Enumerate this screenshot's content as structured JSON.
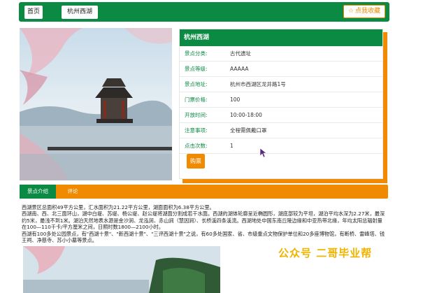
{
  "nav": {
    "home": "首页",
    "current": "杭州西湖",
    "favorite": "点我收藏"
  },
  "panel": {
    "title": "杭州西湖",
    "rows": [
      {
        "k": "景点分类:",
        "v": "古代遗址"
      },
      {
        "k": "景点等级:",
        "v": "AAAAA"
      },
      {
        "k": "景点地址:",
        "v": "杭州市西湖区龙井路1号"
      },
      {
        "k": "门票价格:",
        "v": "100"
      },
      {
        "k": "开放时间:",
        "v": "10:00-18:00"
      },
      {
        "k": "注意事项:",
        "v": "全程需佩戴口罩"
      },
      {
        "k": "点击次数:",
        "v": "1"
      }
    ],
    "buy": "购票"
  },
  "tabs": {
    "intro": "景点介绍",
    "comment": "评论"
  },
  "description": [
    "西湖景区总面积49平方公里，汇水面积为21.22平方公里，湖面面积为6.38平方公里。",
    "西湖南、西、北三面环山，湖中白堤、苏堤、杨公堤、赵公堤将湖面分割成若干水面。西湖的湖体轮廓呈近椭圆形，湖底部较为平坦，湖泊平均水深为2.27米，最深约5米，最浅不到1米。湖泊天然地表水源是金沙涧、龙泓涧、赤山涧（慧因涧）、长桥溪四条溪流。西湖地处中国东南丘陵边缘和中亚热带北缘，年均太阳总辐射量在100—110千卡/平方厘米之间，日照时数1800—2100小时。",
    "西湖有100多处公园景点，有\"西湖十景\"、\"新西湖十景\"、\"三评西湖十景\"之说，有60多处国家、省、市级重点文物保护单位和20多座博物馆，有断桥、雷峰塔、钱王祠、净慈寺、苏小小墓等景点。"
  ],
  "watermark": "公众号  二哥毕业帮",
  "colors": {
    "green": "#0a8a43",
    "orange": "#f08a00"
  },
  "icons": {
    "favorite": "star-icon",
    "cursor": "mouse-pointer-icon"
  }
}
